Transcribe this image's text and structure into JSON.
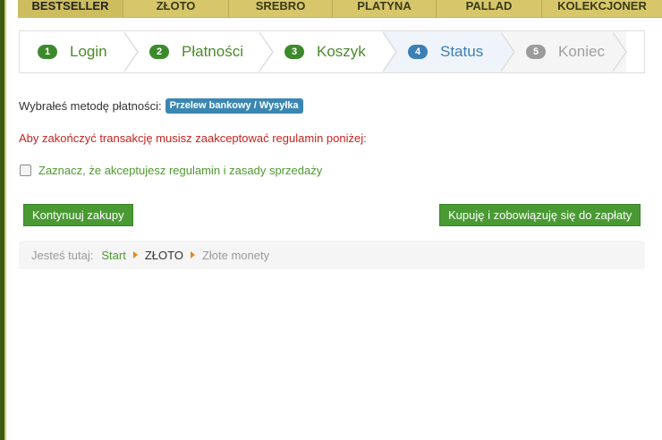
{
  "nav": {
    "items": [
      {
        "label": "BESTSELLER"
      },
      {
        "label": "ZŁOTO"
      },
      {
        "label": "SREBRO"
      },
      {
        "label": "PLATYNA"
      },
      {
        "label": "PALLAD"
      },
      {
        "label": "KOLEKCJONER"
      }
    ]
  },
  "steps": [
    {
      "num": "1",
      "label": "Login"
    },
    {
      "num": "2",
      "label": "Płatności"
    },
    {
      "num": "3",
      "label": "Koszyk"
    },
    {
      "num": "4",
      "label": "Status"
    },
    {
      "num": "5",
      "label": "Koniec"
    }
  ],
  "payment": {
    "label": "Wybrałeś metodę płatności:",
    "method": "Przelew bankowy / Wysyłka"
  },
  "warning": "Aby zakończyć transakcję musisz zaakceptować regulamin poniżej:",
  "terms": {
    "label": "Zaznacz, że akceptujesz regulamin i zasady sprzedaży",
    "checked": false
  },
  "buttons": {
    "continue": "Kontynuuj zakupy",
    "buy": "Kupuję i zobowiązuję się do zapłaty"
  },
  "breadcrumb": {
    "prefix": "Jesteś tutaj:",
    "items": [
      "Start",
      "ZŁOTO",
      "Złote monety"
    ]
  },
  "colors": {
    "accent_green": "#4a9a34",
    "active_step_blue": "#3b7fb5",
    "warning_red": "#c8231e",
    "nav_gold": "#d7c76a"
  }
}
